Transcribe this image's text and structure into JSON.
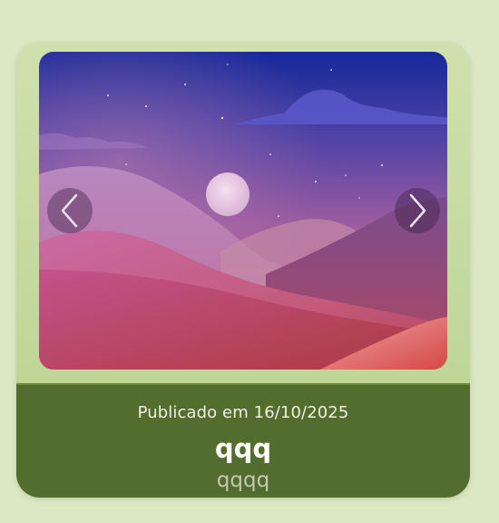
{
  "post": {
    "published_label": "Publicado em 16/10/2025",
    "title": "qqq",
    "description": "qqqq"
  },
  "carousel": {
    "prev_icon": "chevron-left-icon",
    "next_icon": "chevron-right-icon",
    "image_subject": "landscape-illustration"
  },
  "colors": {
    "page_background": "#dce8c4",
    "card_top": "#c8dba6",
    "card_footer": "#536d2e",
    "footer_text": "#f2f4ea",
    "description_text": "#c4c8b4"
  }
}
